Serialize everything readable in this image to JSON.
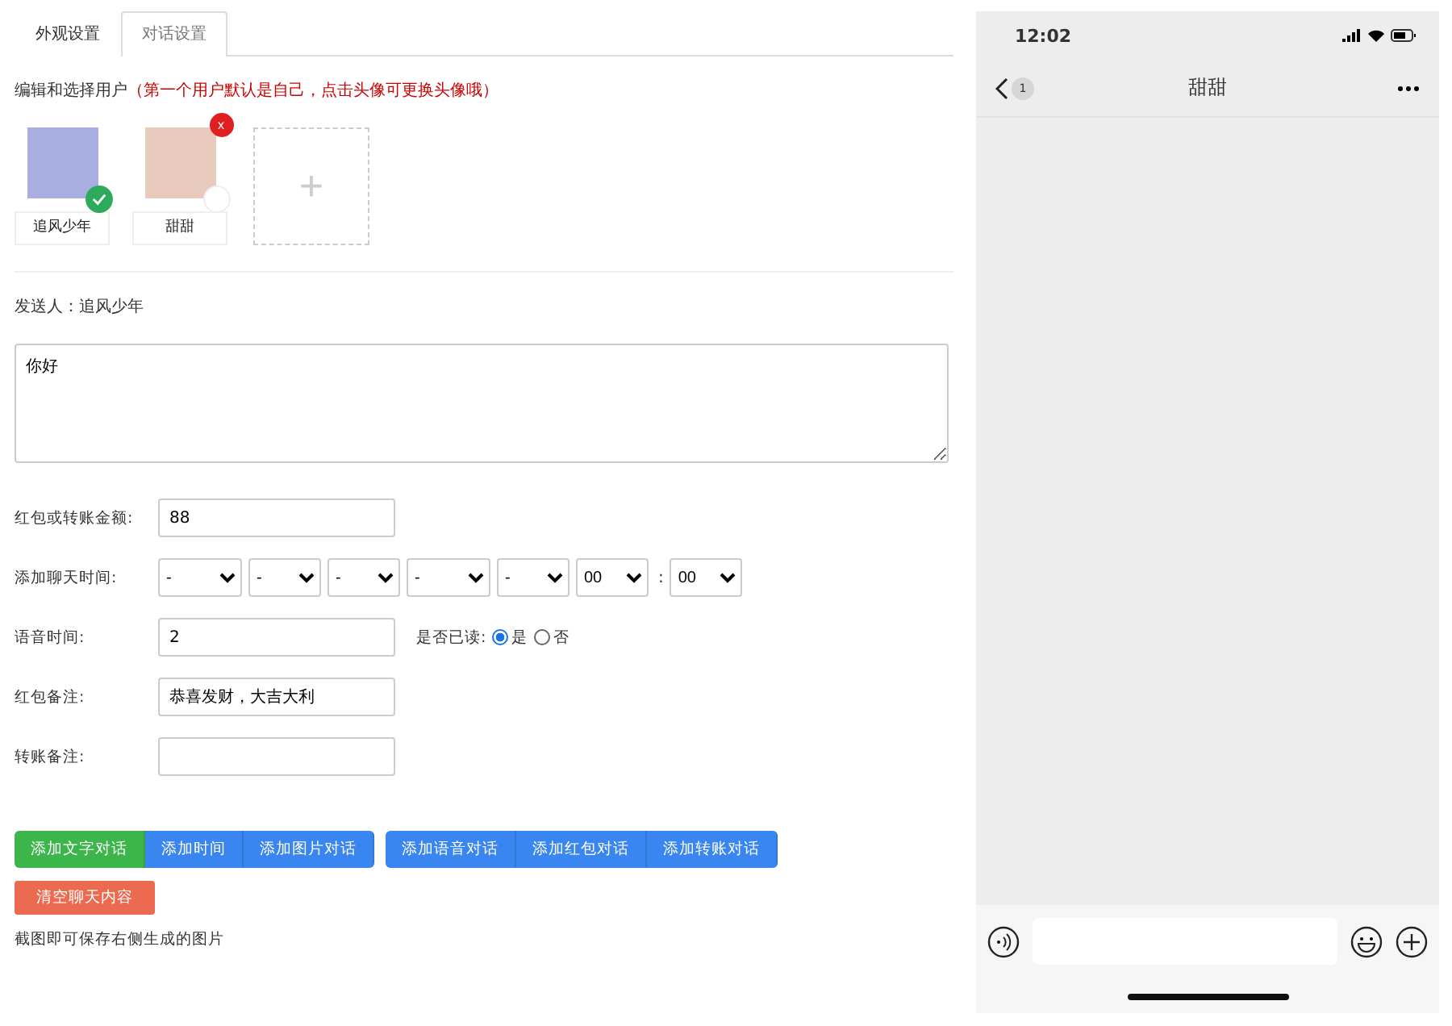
{
  "tabs": [
    {
      "label": "外观设置",
      "selected": false
    },
    {
      "label": "对话设置",
      "selected": true
    }
  ],
  "users_hint": {
    "label": "编辑和选择用户",
    "note": "（第一个用户默认是自己，点击头像可更换头像哦）"
  },
  "users": [
    {
      "name": "追风少年",
      "selected": true,
      "removable": false
    },
    {
      "name": "甜甜",
      "selected": false,
      "removable": true,
      "remove_label": "x"
    }
  ],
  "add_user": {
    "label": "+"
  },
  "sender": "发送人：追风少年",
  "message": {
    "value": "你好"
  },
  "amount": {
    "label": "红包或转账金额:",
    "value": "88"
  },
  "chat_time": {
    "label": "添加聊天时间:",
    "selects": [
      "-",
      "-",
      "-",
      "-",
      "-",
      "00",
      "00"
    ],
    "separator": ":"
  },
  "voice": {
    "label": "语音时间:",
    "value": "2",
    "read_label": "是否已读:",
    "options": [
      {
        "label": "是",
        "selected": true
      },
      {
        "label": "否",
        "selected": false
      }
    ]
  },
  "red_note": {
    "label": "红包备注:",
    "value": "恭喜发财，大吉大利"
  },
  "transfer_note": {
    "label": "转账备注:"
  },
  "button_groups": [
    [
      {
        "label": "添加文字对话",
        "color": "#3cb54a"
      },
      {
        "label": "添加时间",
        "color": "#3a86f0"
      },
      {
        "label": "添加图片对话",
        "color": "#3a86f0"
      }
    ],
    [
      {
        "label": "添加语音对话",
        "color": "#3a86f0"
      },
      {
        "label": "添加红包对话",
        "color": "#3a86f0"
      },
      {
        "label": "添加转账对话",
        "color": "#3a86f0"
      }
    ]
  ],
  "clear_button": "清空聊天内容",
  "footer_note": "截图即可保存右侧生成的图片",
  "phone": {
    "time": "12:02",
    "unread": "1",
    "title": "甜甜"
  }
}
